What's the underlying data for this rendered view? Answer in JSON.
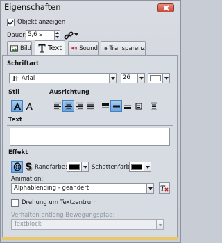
{
  "window": {
    "title": "Eigenschaften"
  },
  "visibility": {
    "checkbox_label": "Objekt anzeigen",
    "checked": true
  },
  "duration": {
    "label": "Dauer:",
    "value": "5,6 s"
  },
  "tabs": [
    {
      "label": "Bild"
    },
    {
      "label": "Text",
      "active": true
    },
    {
      "label": "Sound"
    },
    {
      "label": "Transparenz"
    }
  ],
  "font": {
    "section_label": "Schriftart",
    "family": "Arial",
    "size": "26",
    "color": "#ffffff"
  },
  "style": {
    "section_label": "Stil"
  },
  "alignment": {
    "section_label": "Ausrichtung"
  },
  "text": {
    "section_label": "Text",
    "value": ""
  },
  "effect": {
    "section_label": "Effekt",
    "border_color_label": "Randfarbe:",
    "border_color": "#000000",
    "shadow_color_label": "Schattenfarbe:",
    "shadow_color": "#000000"
  },
  "animation": {
    "label": "Animation:",
    "value": "Alphablending - geändert"
  },
  "rotate": {
    "checkbox_label": "Drehung um Textzentrum",
    "checked": false
  },
  "motion_path": {
    "label": "Verhalten entlang Bewegungspfad:",
    "value": "Textblock"
  },
  "colors": {
    "accent_active": "#6aa6e3",
    "close_red": "#c84a36",
    "bottom_bar": "#e9c86c"
  }
}
